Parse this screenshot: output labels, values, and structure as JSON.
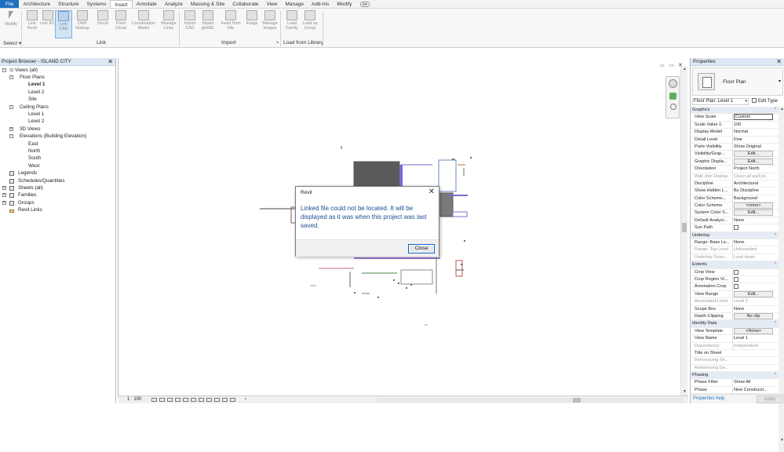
{
  "menu": {
    "tabs": [
      "File",
      "Architecture",
      "Structure",
      "Systems",
      "Insert",
      "Annotate",
      "Analyze",
      "Massing & Site",
      "Collaborate",
      "View",
      "Manage",
      "Add-Ins",
      "Modify"
    ],
    "active_tab": "Insert"
  },
  "ribbon": {
    "buttons": [
      {
        "label": "Modify"
      },
      {
        "label": "Link Revit"
      },
      {
        "label": "Link IFC"
      },
      {
        "label": "Link CAD"
      },
      {
        "label": "DWF Markup"
      },
      {
        "label": "Decal"
      },
      {
        "label": "Point Cloud"
      },
      {
        "label": "Coordination Model"
      },
      {
        "label": "Manage Links"
      },
      {
        "label": "Import CAD"
      },
      {
        "label": "Import gbXML"
      },
      {
        "label": "Insert from File"
      },
      {
        "label": "Image"
      },
      {
        "label": "Manage Images"
      },
      {
        "label": "Load Family"
      },
      {
        "label": "Load as Group"
      }
    ],
    "panels": [
      "Select",
      "Link",
      "Import",
      "Load from Library"
    ]
  },
  "project_browser": {
    "title": "Project Browser - ISLAND CITY",
    "items": [
      {
        "label": "Views (all)"
      },
      {
        "label": "Floor Plans"
      },
      {
        "label": "Level 1"
      },
      {
        "label": "Level 2"
      },
      {
        "label": "Site"
      },
      {
        "label": "Ceiling Plans"
      },
      {
        "label": "Level 1"
      },
      {
        "label": "Level 2"
      },
      {
        "label": "3D Views"
      },
      {
        "label": "Elevations (Building Elevation)"
      },
      {
        "label": "East"
      },
      {
        "label": "North"
      },
      {
        "label": "South"
      },
      {
        "label": "West"
      },
      {
        "label": "Legends"
      },
      {
        "label": "Schedules/Quantities"
      },
      {
        "label": "Sheets (all)"
      },
      {
        "label": "Families"
      },
      {
        "label": "Groups"
      },
      {
        "label": "Revit Links"
      }
    ]
  },
  "dialog": {
    "title": "Revit",
    "message": "Linked file  could not be located. It will be displayed as it was when this project was last saved.",
    "close_label": "Close"
  },
  "statusbar": {
    "scale": "1 : 100"
  },
  "properties": {
    "title": "Properties",
    "type_name": "Floor Plan",
    "filter": "Floor Plan: Level 1",
    "edit_type": "Edit Type",
    "rows": [
      {
        "group": "Graphics"
      },
      {
        "k": "View Scale",
        "v": "Custom"
      },
      {
        "k": "Scale Value    1:",
        "v": "100"
      },
      {
        "k": "Display Model",
        "v": "Normal"
      },
      {
        "k": "Detail Level",
        "v": "Fine"
      },
      {
        "k": "Parts Visibility",
        "v": "Show Original"
      },
      {
        "k": "Visibility/Grap...",
        "v": "Edit..."
      },
      {
        "k": "Graphic Displa...",
        "v": "Edit..."
      },
      {
        "k": "Orientation",
        "v": "Project North"
      },
      {
        "k": "Wall Join Display",
        "v": "Clean all wall joi..."
      },
      {
        "k": "Discipline",
        "v": "Architectural"
      },
      {
        "k": "Show Hidden L...",
        "v": "By Discipline"
      },
      {
        "k": "Color Scheme...",
        "v": "Background"
      },
      {
        "k": "Color Scheme",
        "v": "<none>"
      },
      {
        "k": "System Color S...",
        "v": "Edit..."
      },
      {
        "k": "Default Analysi...",
        "v": "None"
      },
      {
        "k": "Sun Path",
        "v": ""
      },
      {
        "group": "Underlay"
      },
      {
        "k": "Range: Base Le...",
        "v": "None"
      },
      {
        "k": "Range: Top Level",
        "v": "Unbounded"
      },
      {
        "k": "Underlay Orien...",
        "v": "Look down"
      },
      {
        "group": "Extents"
      },
      {
        "k": "Crop View",
        "v": ""
      },
      {
        "k": "Crop Region Vi...",
        "v": ""
      },
      {
        "k": "Annotation Crop",
        "v": ""
      },
      {
        "k": "View Range",
        "v": "Edit..."
      },
      {
        "k": "Associated Level",
        "v": "Level 1"
      },
      {
        "k": "Scope Box",
        "v": "None"
      },
      {
        "k": "Depth Clipping",
        "v": "No clip"
      },
      {
        "group": "Identity Data"
      },
      {
        "k": "View Template",
        "v": "<None>"
      },
      {
        "k": "View Name",
        "v": "Level 1"
      },
      {
        "k": "Dependency",
        "v": "Independent"
      },
      {
        "k": "Title on Sheet",
        "v": ""
      },
      {
        "k": "Referencing Sh...",
        "v": ""
      },
      {
        "k": "Referencing De...",
        "v": ""
      },
      {
        "group": "Phasing"
      },
      {
        "k": "Phase Filter",
        "v": "Show All"
      },
      {
        "k": "Phase",
        "v": "New Constructi..."
      }
    ],
    "help": "Properties help",
    "apply": "Apply"
  }
}
